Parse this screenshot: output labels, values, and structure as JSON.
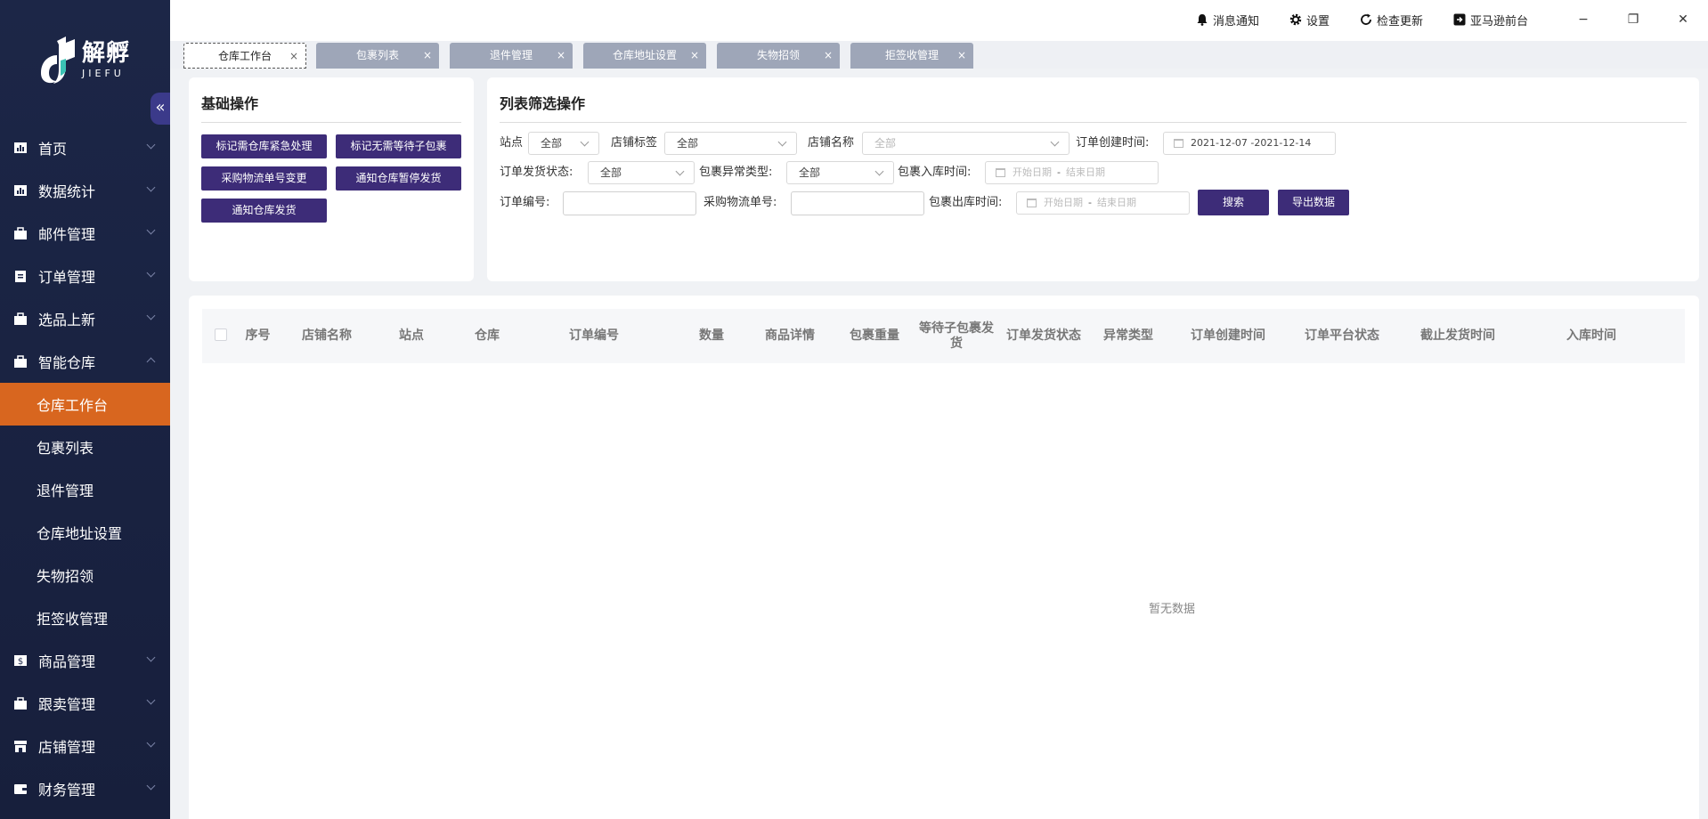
{
  "app": {
    "logo_cn": "解孵",
    "logo_en": "JIEFU",
    "collapse_glyph": "«"
  },
  "sidebar": {
    "menu": [
      {
        "label": "首页",
        "icon": "bar-chart-icon"
      },
      {
        "label": "数据统计",
        "icon": "bar-chart-icon"
      },
      {
        "label": "邮件管理",
        "icon": "briefcase-icon"
      },
      {
        "label": "订单管理",
        "icon": "clipboard-icon"
      },
      {
        "label": "选品上新",
        "icon": "briefcase-icon"
      },
      {
        "label": "智能仓库",
        "icon": "briefcase-icon",
        "expanded": true
      }
    ],
    "submenu": [
      {
        "label": "仓库工作台",
        "active": true
      },
      {
        "label": "包裹列表"
      },
      {
        "label": "退件管理"
      },
      {
        "label": "仓库地址设置"
      },
      {
        "label": "失物招领"
      },
      {
        "label": "拒签收管理"
      }
    ],
    "menu_after": [
      {
        "label": "商品管理",
        "icon": "dollar-box-icon"
      },
      {
        "label": "跟卖管理",
        "icon": "briefcase-icon"
      },
      {
        "label": "店铺管理",
        "icon": "store-icon"
      },
      {
        "label": "财务管理",
        "icon": "wallet-icon"
      }
    ]
  },
  "topbar": {
    "notifications": "消息通知",
    "settings": "设置",
    "check_update": "检查更新",
    "amazon_front": "亚马逊前台",
    "minimize": "−",
    "restore": "❐",
    "close": "✕"
  },
  "tabs": [
    {
      "label": "仓库工作台",
      "active": true
    },
    {
      "label": "包裹列表"
    },
    {
      "label": "退件管理"
    },
    {
      "label": "仓库地址设置"
    },
    {
      "label": "失物招领"
    },
    {
      "label": "拒签收管理"
    }
  ],
  "tab_close": "×",
  "basic_ops": {
    "title": "基础操作",
    "buttons": [
      "标记需仓库紧急处理",
      "标记无需等待子包裹",
      "采购物流单号变更",
      "通知仓库暂停发货",
      "通知仓库发货"
    ]
  },
  "filters": {
    "title": "列表筛选操作",
    "site_label": "站点",
    "site_value": "全部",
    "store_tag_label": "店铺标签",
    "store_tag_value": "全部",
    "store_name_label": "店铺名称",
    "store_name_placeholder": "全部",
    "order_created_label": "订单创建时间:",
    "order_created_range": "2021-12-07  -2021-12-14",
    "ship_status_label": "订单发货状态:",
    "ship_status_value": "全部",
    "pkg_exception_label": "包裹异常类型:",
    "pkg_exception_value": "全部",
    "pkg_in_label": "包裹入库时间:",
    "pkg_out_label": "包裹出库时间:",
    "start_placeholder": "开始日期",
    "end_placeholder": "结束日期",
    "date_sep": "-",
    "order_no_label": "订单编号:",
    "purchase_no_label": "采购物流单号:",
    "search_btn": "搜索",
    "export_btn": "导出数据"
  },
  "table": {
    "columns": [
      "序号",
      "店铺名称",
      "站点",
      "仓库",
      "订单编号",
      "数量",
      "商品详情",
      "包裹重量",
      "等待子包裹发货",
      "订单发货状态",
      "异常类型",
      "订单创建时间",
      "订单平台状态",
      "截止发货时间",
      "入库时间"
    ],
    "empty_text": "暂无数据"
  }
}
